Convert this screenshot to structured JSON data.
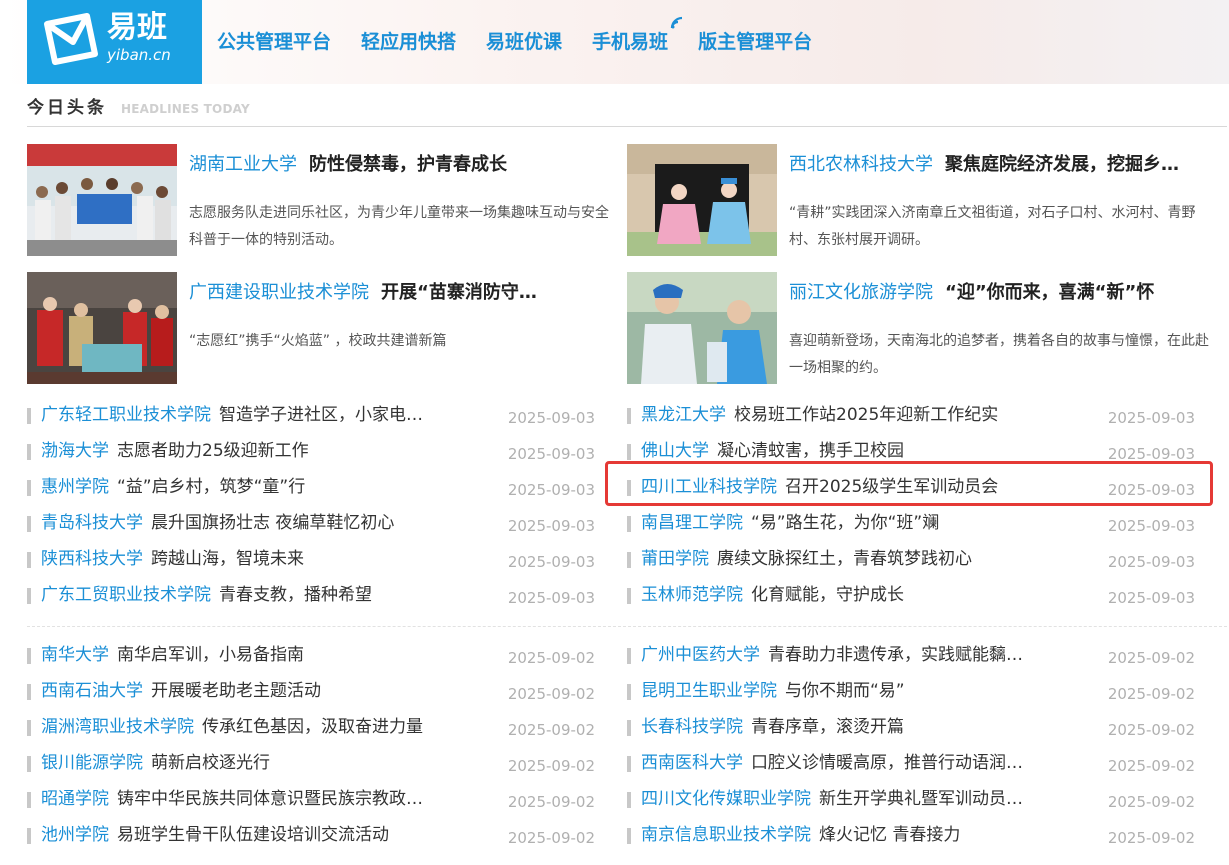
{
  "header": {
    "logo_text": "易班",
    "logo_sub": "yiban.cn",
    "nav": [
      "公共管理平台",
      "轻应用快搭",
      "易班优课",
      "手机易班",
      "版主管理平台"
    ]
  },
  "section": {
    "title_cn": "今日头条",
    "title_en": "HEADLINES TODAY"
  },
  "featured": [
    {
      "school": "湖南工业大学",
      "title": "防性侵禁毒，护青春成长",
      "desc": "志愿服务队走进同乐社区，为青少年儿童带来一场集趣味互动与安全科普于一体的特别活动。"
    },
    {
      "school": "西北农林科技大学",
      "title": "聚焦庭院经济发展，挖掘乡…",
      "desc": "“青耕”实践团深入济南章丘文祖街道，对石子口村、水河村、青野村、东张村展开调研。"
    },
    {
      "school": "广西建设职业技术学院",
      "title": "开展“苗寨消防守…",
      "desc": "“志愿红”携手“火焰蓝” ，校政共建谱新篇"
    },
    {
      "school": "丽江文化旅游学院",
      "title": "“迎”你而来，喜满“新”怀",
      "desc": "喜迎萌新登场，天南海北的追梦者，携着各自的故事与憧憬，在此赴一场相聚的约。"
    }
  ],
  "lists": {
    "top_left": [
      {
        "school": "广东轻工职业技术学院",
        "title": "智造学子进社区，小家电…",
        "date": "2025-09-03"
      },
      {
        "school": "渤海大学",
        "title": "志愿者助力25级迎新工作",
        "date": "2025-09-03"
      },
      {
        "school": "惠州学院",
        "title": "“益”启乡村，筑梦“童”行",
        "date": "2025-09-03"
      },
      {
        "school": "青岛科技大学",
        "title": "晨升国旗扬壮志 夜编草鞋忆初心",
        "date": "2025-09-03"
      },
      {
        "school": "陕西科技大学",
        "title": "跨越山海，智境未来",
        "date": "2025-09-03"
      },
      {
        "school": "广东工贸职业技术学院",
        "title": "青春支教，播种希望",
        "date": "2025-09-03"
      }
    ],
    "top_right": [
      {
        "school": "黑龙江大学",
        "title": "校易班工作站2025年迎新工作纪实",
        "date": "2025-09-03"
      },
      {
        "school": "佛山大学",
        "title": "凝心清蚊害，携手卫校园",
        "date": "2025-09-03"
      },
      {
        "school": "四川工业科技学院",
        "title": "召开2025级学生军训动员会",
        "date": "2025-09-03"
      },
      {
        "school": "南昌理工学院",
        "title": "“易”路生花，为你“班”斓",
        "date": "2025-09-03"
      },
      {
        "school": "莆田学院",
        "title": "赓续文脉探红土，青春筑梦践初心",
        "date": "2025-09-03"
      },
      {
        "school": "玉林师范学院",
        "title": "化育赋能，守护成长",
        "date": "2025-09-03"
      }
    ],
    "bottom_left": [
      {
        "school": "南华大学",
        "title": "南华启军训，小易备指南",
        "date": "2025-09-02"
      },
      {
        "school": "西南石油大学",
        "title": "开展暖老助老主题活动",
        "date": "2025-09-02"
      },
      {
        "school": "湄洲湾职业技术学院",
        "title": "传承红色基因，汲取奋进力量",
        "date": "2025-09-02"
      },
      {
        "school": "银川能源学院",
        "title": "萌新启校逐光行",
        "date": "2025-09-02"
      },
      {
        "school": "昭通学院",
        "title": "铸牢中华民族共同体意识暨民族宗教政…",
        "date": "2025-09-02"
      },
      {
        "school": "池州学院",
        "title": "易班学生骨干队伍建设培训交流活动",
        "date": "2025-09-02"
      }
    ],
    "bottom_right": [
      {
        "school": "广州中医药大学",
        "title": "青春助力非遗传承，实践赋能黐…",
        "date": "2025-09-02"
      },
      {
        "school": "昆明卫生职业学院",
        "title": "与你不期而“易”",
        "date": "2025-09-02"
      },
      {
        "school": "长春科技学院",
        "title": "青春序章，滚烫开篇",
        "date": "2025-09-02"
      },
      {
        "school": "西南医科大学",
        "title": "口腔义诊情暖高原，推普行动语润…",
        "date": "2025-09-02"
      },
      {
        "school": "四川文化传媒职业学院",
        "title": "新生开学典礼暨军训动员…",
        "date": "2025-09-02"
      },
      {
        "school": "南京信息职业技术学院",
        "title": "烽火记忆 青春接力",
        "date": "2025-09-02"
      }
    ]
  }
}
